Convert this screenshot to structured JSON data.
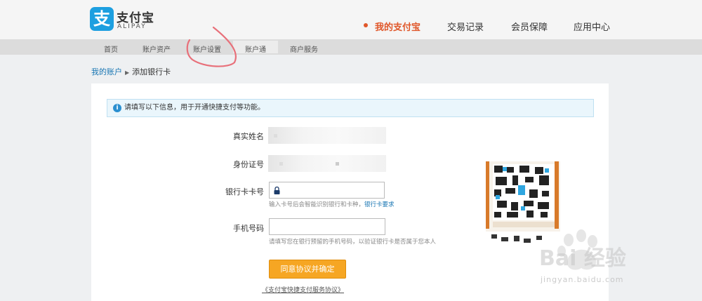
{
  "logo": {
    "cn": "支付宝",
    "en": "ALIPAY",
    "mark": "支"
  },
  "main_nav": [
    {
      "label": "我的支付宝",
      "active": true
    },
    {
      "label": "交易记录"
    },
    {
      "label": "会员保障"
    },
    {
      "label": "应用中心"
    }
  ],
  "sub_nav": [
    "首页",
    "账户资产",
    "账户设置",
    "账户通",
    "商户服务"
  ],
  "breadcrumb": {
    "home": "我的账户",
    "separator": "▶",
    "current": "添加银行卡"
  },
  "notice": "请填写以下信息，用于开通快捷支付等功能。",
  "form": {
    "real_name_label": "真实姓名",
    "id_label": "身份证号",
    "card_label": "银行卡卡号",
    "card_hint": "输入卡号后会智能识别银行和卡种，",
    "card_hint_link": "银行卡要求",
    "phone_label": "手机号码",
    "phone_hint": "请填写您在银行预留的手机号码，以验证银行卡是否属于您本人",
    "submit_label": "同意协议并确定",
    "agreement": "《支付宝快捷支付服务协议》"
  },
  "watermark": {
    "text": "Bai 经验",
    "url": "jingyan.baidu.com"
  },
  "colors": {
    "accent": "#e0572a",
    "brand": "#1d9fe0",
    "button": "#f6a623",
    "link": "#1976b3"
  }
}
